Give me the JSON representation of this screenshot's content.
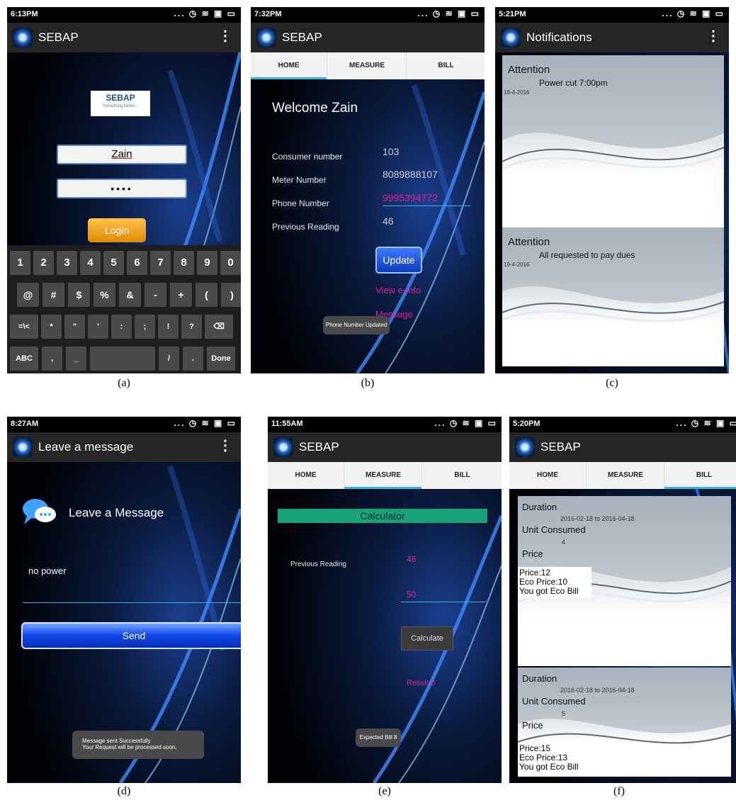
{
  "status_icons": "... ◷ ≋ ▣ ▭",
  "panel_a": {
    "time": "6:13PM",
    "title": "SEBAP",
    "logo_title": "SEBAP",
    "logo_sub": "Something better...",
    "username": "Zain",
    "password_mask": "••••",
    "login_label": "Login",
    "keyboard": {
      "row1": [
        "1",
        "2",
        "3",
        "4",
        "5",
        "6",
        "7",
        "8",
        "9",
        "0"
      ],
      "row2": [
        "@",
        "#",
        "$",
        "%",
        "&",
        "-",
        "+",
        "(",
        ")"
      ],
      "row3": [
        "=\\<",
        "*",
        "\"",
        "'",
        ":",
        ";",
        "!",
        "?",
        "⌫"
      ],
      "row4": [
        "ABC",
        ",",
        "_",
        "",
        "/",
        ".",
        "Done"
      ]
    },
    "caption": "(a)"
  },
  "panel_b": {
    "time": "7:32PM",
    "title": "SEBAP",
    "tabs": [
      "HOME",
      "MEASURE",
      "BILL"
    ],
    "welcome": "Welcome Zain",
    "rows": [
      {
        "label": "Consumer number",
        "value": "103"
      },
      {
        "label": "Meter Number",
        "value": "8089888107"
      },
      {
        "label": "Phone Number",
        "value": "9995394772"
      },
      {
        "label": "Previous Reading",
        "value": "46"
      }
    ],
    "update_label": "Update",
    "link1": "View e-info",
    "link2": "Message",
    "toast": "Phone Number Updated",
    "caption": "(b)"
  },
  "panel_c": {
    "time": "5:21PM",
    "title": "Notifications",
    "items": [
      {
        "heading": "Attention",
        "text": "Power cut 7:00pm",
        "date": "18-4-2016"
      },
      {
        "heading": "Attention",
        "text": "All requested to pay dues",
        "date": "19-4-2016"
      }
    ],
    "caption": "(c)"
  },
  "panel_d": {
    "time": "8:27AM",
    "title": "Leave a message",
    "heading": "Leave a Message",
    "message_value": "no power",
    "send_label": "Send",
    "toast_line1": "Message sent Successfully",
    "toast_line2": "Your Request will be processed soon.",
    "caption": "(d)"
  },
  "panel_e": {
    "time": "11:55AM",
    "title": "SEBAP",
    "tabs": [
      "HOME",
      "MEASURE",
      "BILL"
    ],
    "calculator_label": "Calculator",
    "prev_label": "Previous Reading",
    "prev_value": "46",
    "current_value": "50",
    "calculate_label": "Calculate",
    "result": "Result 8",
    "toast": "Expected Bill 8",
    "caption": "(e)"
  },
  "panel_f": {
    "time": "5:20PM",
    "title": "SEBAP",
    "tabs": [
      "HOME",
      "MEASURE",
      "BILL"
    ],
    "cards": [
      {
        "duration_label": "Duration",
        "duration": "2016-02-18 to 2016-04-18",
        "unit_label": "Unit Consumed",
        "unit": "4",
        "price_label": "Price",
        "price_lines": [
          "Price:12",
          "Eco Price:10",
          "You got Eco Bill"
        ]
      },
      {
        "duration_label": "Duration",
        "duration": "2016-02-18 to 2016-04-18",
        "unit_label": "Unit Consumed",
        "unit": "5",
        "price_label": "Price",
        "price_lines": [
          "Price:15",
          "Eco Price:13",
          "You got Eco Bill"
        ]
      }
    ],
    "caption": "(f)"
  }
}
